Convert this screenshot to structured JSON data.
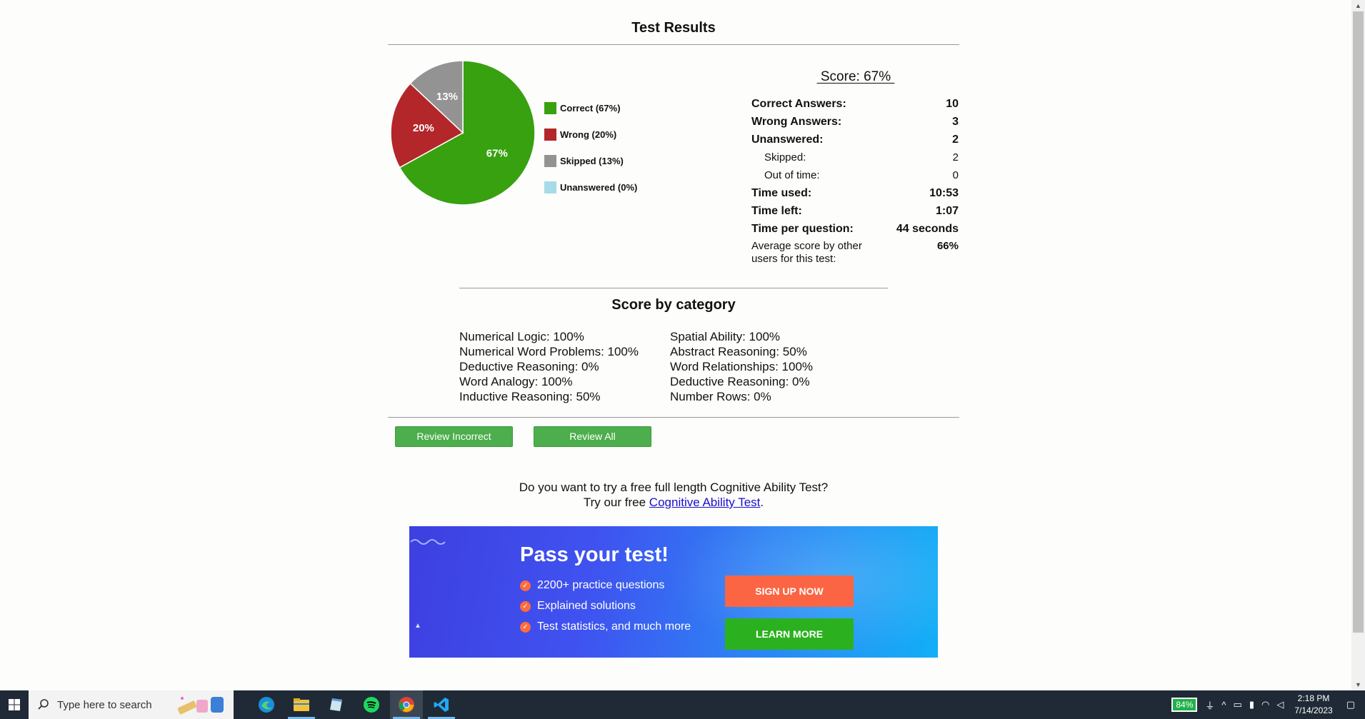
{
  "page": {
    "title": "Test Results"
  },
  "chart_data": {
    "type": "pie",
    "slices": [
      {
        "name": "Correct",
        "value": 67,
        "color": "#37a110",
        "label": "67%"
      },
      {
        "name": "Wrong",
        "value": 20,
        "color": "#b3262a",
        "label": "20%"
      },
      {
        "name": "Skipped",
        "value": 13,
        "color": "#939393",
        "label": "13%"
      },
      {
        "name": "Unanswered",
        "value": 0,
        "color": "#a7dbe8",
        "label": "0%"
      }
    ],
    "legend": [
      "Correct (67%)",
      "Wrong (20%)",
      "Skipped (13%)",
      "Unanswered (0%)"
    ],
    "legend_position": "right"
  },
  "score": {
    "title": " Score: 67% ",
    "rows": [
      {
        "label": "Correct Answers:",
        "value": "10"
      },
      {
        "label": "Wrong Answers:",
        "value": "3"
      },
      {
        "label": "Unanswered:",
        "value": "2"
      },
      {
        "label": "Skipped:",
        "value": "2"
      },
      {
        "label": "Out of time:",
        "value": "0"
      },
      {
        "label": "Time used:",
        "value": "10:53"
      },
      {
        "label": "Time left:",
        "value": "1:07"
      },
      {
        "label": "Time per question:",
        "value": "44 seconds"
      },
      {
        "label": "Average score by other users for this test:",
        "value": "66%"
      }
    ]
  },
  "categories": {
    "title": "Score by category",
    "left": [
      "Numerical Logic: 100%",
      "Numerical Word Problems: 100%",
      "Deductive Reasoning: 0%",
      "Word Analogy: 100%",
      "Inductive Reasoning: 50%"
    ],
    "right": [
      "Spatial Ability: 100%",
      "Abstract Reasoning: 50%",
      "Word Relationships: 100%",
      "Deductive Reasoning: 0%",
      "Number Rows: 0%"
    ]
  },
  "buttons": {
    "review_incorrect": "Review Incorrect",
    "review_all": "Review All"
  },
  "promo": {
    "line1": "Do you want to try a free full length Cognitive Ability Test?",
    "line2_prefix": "Try our free ",
    "link": "Cognitive Ability Test",
    "line2_suffix": "."
  },
  "banner": {
    "title": "Pass your test!",
    "features": [
      "2200+ practice questions",
      "Explained solutions",
      "Test statistics, and much more"
    ],
    "signup": "SIGN UP NOW",
    "learn_more": "LEARN MORE",
    "signup_color": "#fb6543",
    "learn_color": "#2bb11f"
  },
  "taskbar": {
    "search_placeholder": "Type here to search",
    "battery": "84%",
    "time": "2:18 PM",
    "date": "7/14/2023",
    "apps": [
      "edge-icon",
      "file-explorer-icon",
      "notepad-icon",
      "spotify-icon",
      "chrome-icon",
      "vscode-icon"
    ]
  }
}
